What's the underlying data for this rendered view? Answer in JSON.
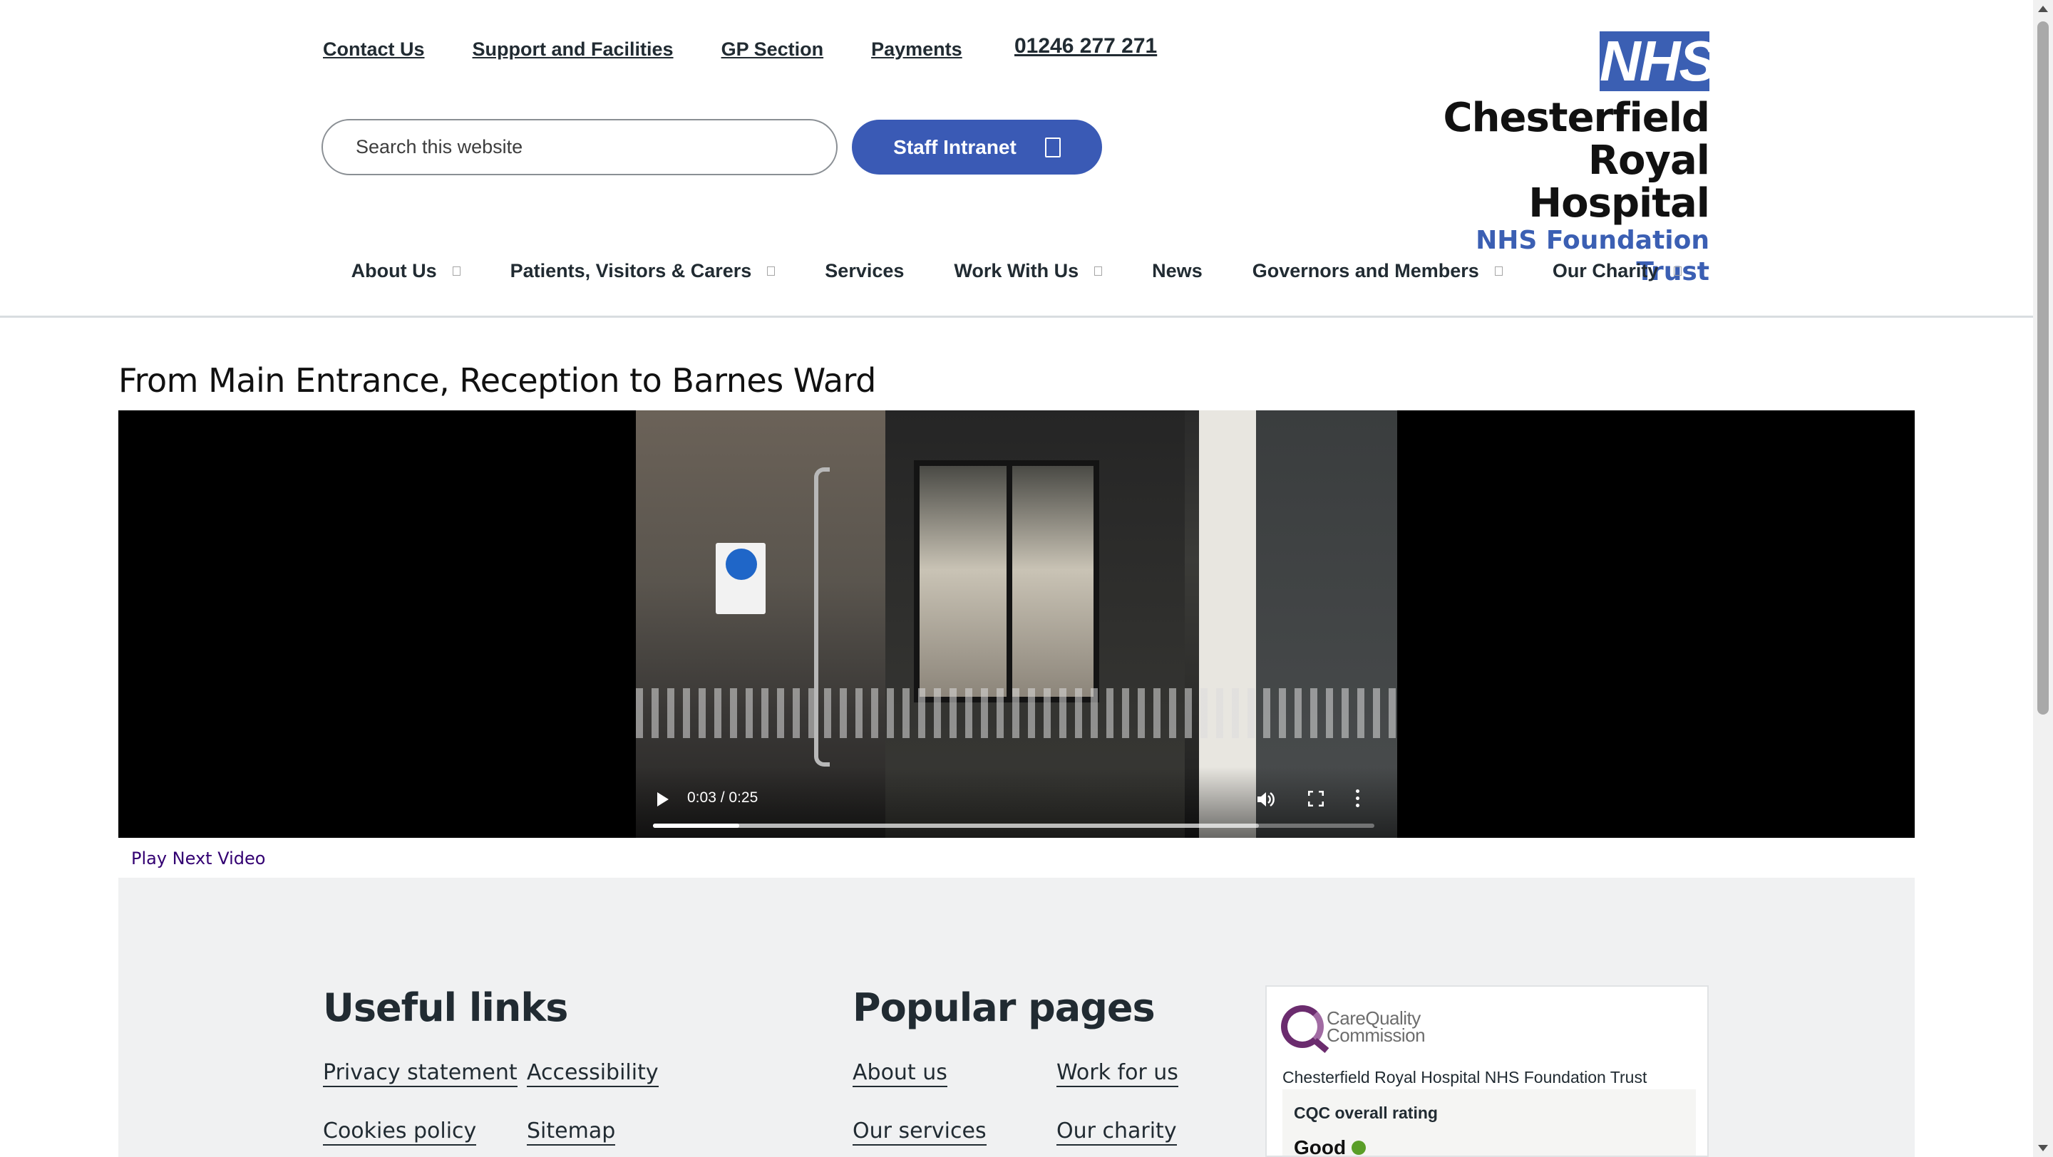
{
  "header": {
    "top_links": [
      "Contact Us",
      "Support and Facilities",
      "GP Section",
      "Payments"
    ],
    "phone": "01246 277 271",
    "search_placeholder": "Search this website",
    "staff_intranet_label": "Staff Intranet",
    "logo": {
      "nhs": "NHS",
      "line1": "Chesterfield",
      "line2": "Royal Hospital",
      "line3": "NHS Foundation Trust"
    }
  },
  "nav": {
    "items": [
      {
        "label": "About Us",
        "has_submenu": true
      },
      {
        "label": "Patients, Visitors & Carers",
        "has_submenu": true
      },
      {
        "label": "Services",
        "has_submenu": false
      },
      {
        "label": "Work With Us",
        "has_submenu": true
      },
      {
        "label": "News",
        "has_submenu": false
      },
      {
        "label": "Governors and Members",
        "has_submenu": true
      },
      {
        "label": "Our Charity",
        "has_submenu": true
      }
    ]
  },
  "main": {
    "title": "From Main Entrance, Reception to Barnes Ward",
    "video": {
      "time": "0:03 / 0:25",
      "played_fraction": 0.12,
      "buffered_fraction": 0.84
    },
    "play_next_label": "Play Next Video"
  },
  "footer": {
    "useful_links": {
      "heading": "Useful links",
      "links": [
        "Privacy statement",
        "Accessibility",
        "Cookies policy",
        "Sitemap"
      ]
    },
    "popular_pages": {
      "heading": "Popular pages",
      "links": [
        "About us",
        "Work for us",
        "Our services",
        "Our charity"
      ]
    },
    "cqc": {
      "name_line1": "CareQuality",
      "name_line2": "Commission",
      "organisation": "Chesterfield Royal Hospital NHS Foundation Trust",
      "rating_label": "CQC overall rating",
      "rating": "Good",
      "rating_color": "#5a9e28"
    }
  },
  "colors": {
    "brand_blue": "#3b5fb3",
    "button_blue": "#3a5ab5",
    "visited_link": "#330072",
    "footer_bg": "#f0f1f2"
  }
}
